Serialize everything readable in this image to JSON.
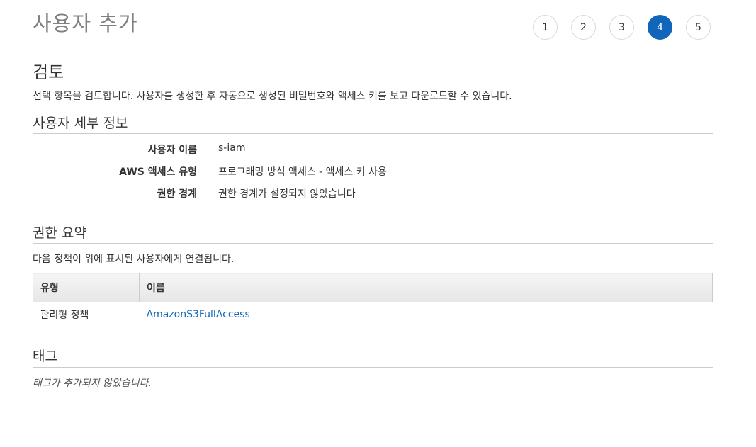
{
  "header": {
    "title": "사용자 추가",
    "steps": [
      "1",
      "2",
      "3",
      "4",
      "5"
    ],
    "active_step": "4"
  },
  "review": {
    "title": "검토",
    "description": "선택 항목을 검토합니다. 사용자를 생성한 후 자동으로 생성된 비밀번호와 액세스 키를 보고 다운로드할 수 있습니다."
  },
  "user_details": {
    "title": "사용자 세부 정보",
    "rows": [
      {
        "label": "사용자 이름",
        "value": "s-iam"
      },
      {
        "label": "AWS 액세스 유형",
        "value": "프로그래밍 방식 액세스 - 액세스 키 사용"
      },
      {
        "label": "권한 경계",
        "value": "권한 경계가 설정되지 않았습니다"
      }
    ]
  },
  "permissions": {
    "title": "권한 요약",
    "description": "다음 정책이 위에 표시된 사용자에게 연결됩니다.",
    "columns": {
      "type": "유형",
      "name": "이름"
    },
    "rows": [
      {
        "type": "관리형 정책",
        "name": "AmazonS3FullAccess"
      }
    ]
  },
  "tags": {
    "title": "태그",
    "empty_text": "태그가 추가되지 않았습니다."
  },
  "colors": {
    "accent": "#1166bb",
    "rule": "#cccccc",
    "title_gray": "#808080"
  }
}
